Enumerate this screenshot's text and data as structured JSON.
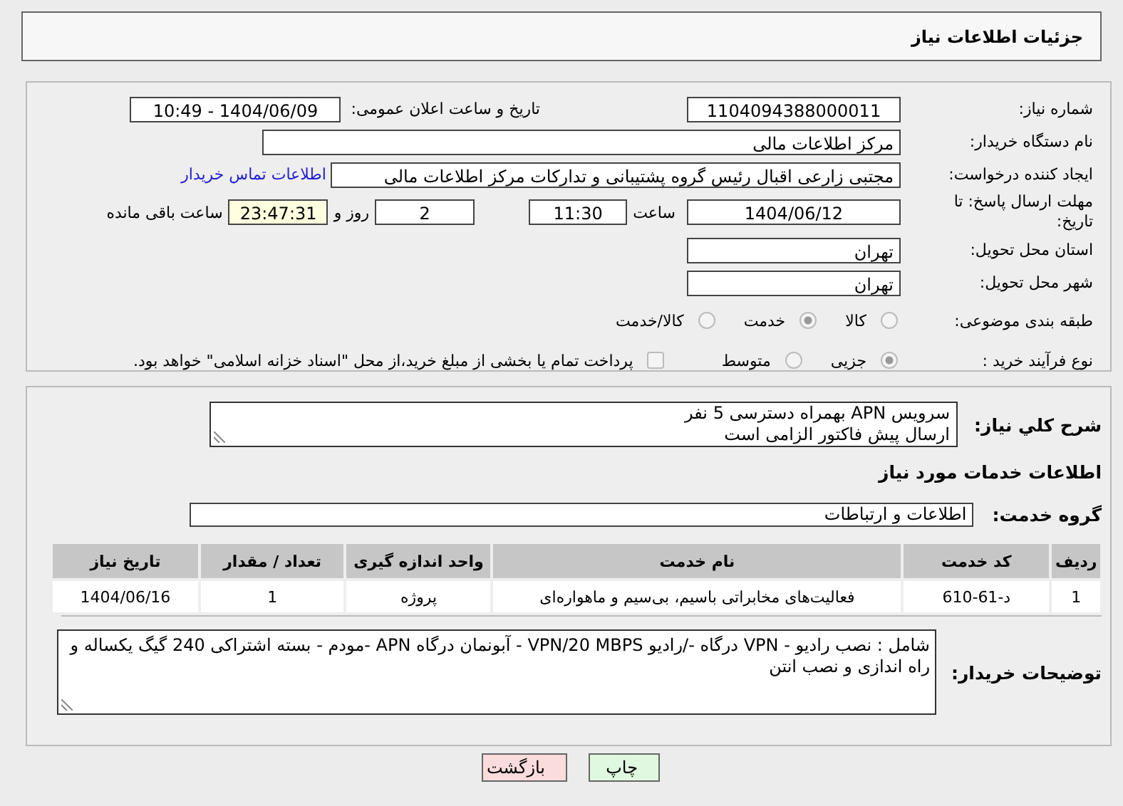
{
  "header": {
    "title": "جزئیات اطلاعات نیاز"
  },
  "details": {
    "need_number": {
      "label": "شماره نیاز:",
      "value": "1104094388000011"
    },
    "announce": {
      "label": "تاریخ و ساعت اعلان عمومی:",
      "value": "1404/06/09 - 10:49"
    },
    "buyer_org": {
      "label": "نام دستگاه خریدار:",
      "value": "مرکز اطلاعات مالی"
    },
    "requester": {
      "label": "ایجاد کننده درخواست:",
      "value": "مجتبی زارعی اقبال رئیس گروه پشتیبانی و تدارکات مرکز اطلاعات مالی",
      "link": "اطلاعات تماس خریدار"
    },
    "deadline": {
      "label": "مهلت ارسال پاسخ: تا تاریخ:",
      "date": "1404/06/12",
      "time_label": "ساعت",
      "time": "11:30",
      "days": "2",
      "days_label": "روز و",
      "remaining": "23:47:31",
      "remaining_label": "ساعت باقی مانده"
    },
    "province": {
      "label": "استان محل تحویل:",
      "value": "تهران"
    },
    "city": {
      "label": "شهر محل تحویل:",
      "value": "تهران"
    },
    "category": {
      "label": "طبقه بندی موضوعی:",
      "options": [
        {
          "label": "کالا",
          "selected": false
        },
        {
          "label": "خدمت",
          "selected": true
        },
        {
          "label": "کالا/خدمت",
          "selected": false
        }
      ]
    },
    "process": {
      "label": "نوع فرآیند خرید :",
      "options": [
        {
          "label": "جزیی",
          "selected": true
        },
        {
          "label": "متوسط",
          "selected": false
        }
      ],
      "treasury": {
        "label": "پرداخت تمام یا بخشی از مبلغ خرید،از محل \"اسناد خزانه اسلامی\" خواهد بود.",
        "checked": false
      }
    }
  },
  "services": {
    "summary": {
      "label": "شرح کلي نياز:",
      "value": "سرویس APN بهمراه دسترسی  5 نفر\nارسال پیش فاکتور الزامی است"
    },
    "heading": "اطلاعات خدمات مورد نیاز",
    "group": {
      "label": "گروه خدمت:",
      "value": "اطلاعات و ارتباطات"
    },
    "table": {
      "columns": [
        "ردیف",
        "کد خدمت",
        "نام خدمت",
        "واحد اندازه گیری",
        "تعداد / مقدار",
        "تاریخ نیاز"
      ],
      "rows": [
        [
          "1",
          "د-61-610",
          "فعالیت‌های مخابراتی باسیم، بی‌سیم و ماهواره‌ای",
          "پروژه",
          "1",
          "1404/06/16"
        ]
      ]
    },
    "notes": {
      "label": "توضیحات خریدار:",
      "value": "شامل : نصب رادیو - VPN   درگاه -/رادیو VPN/20 MBPS - آبونمان درگاه APN -مودم - بسته اشتراکی 240 گیگ یکساله و راه اندازی و نصب انتن"
    }
  },
  "buttons": [
    {
      "label": "چاپ",
      "kind": "print"
    },
    {
      "label": "بازگشت",
      "kind": "back"
    }
  ]
}
